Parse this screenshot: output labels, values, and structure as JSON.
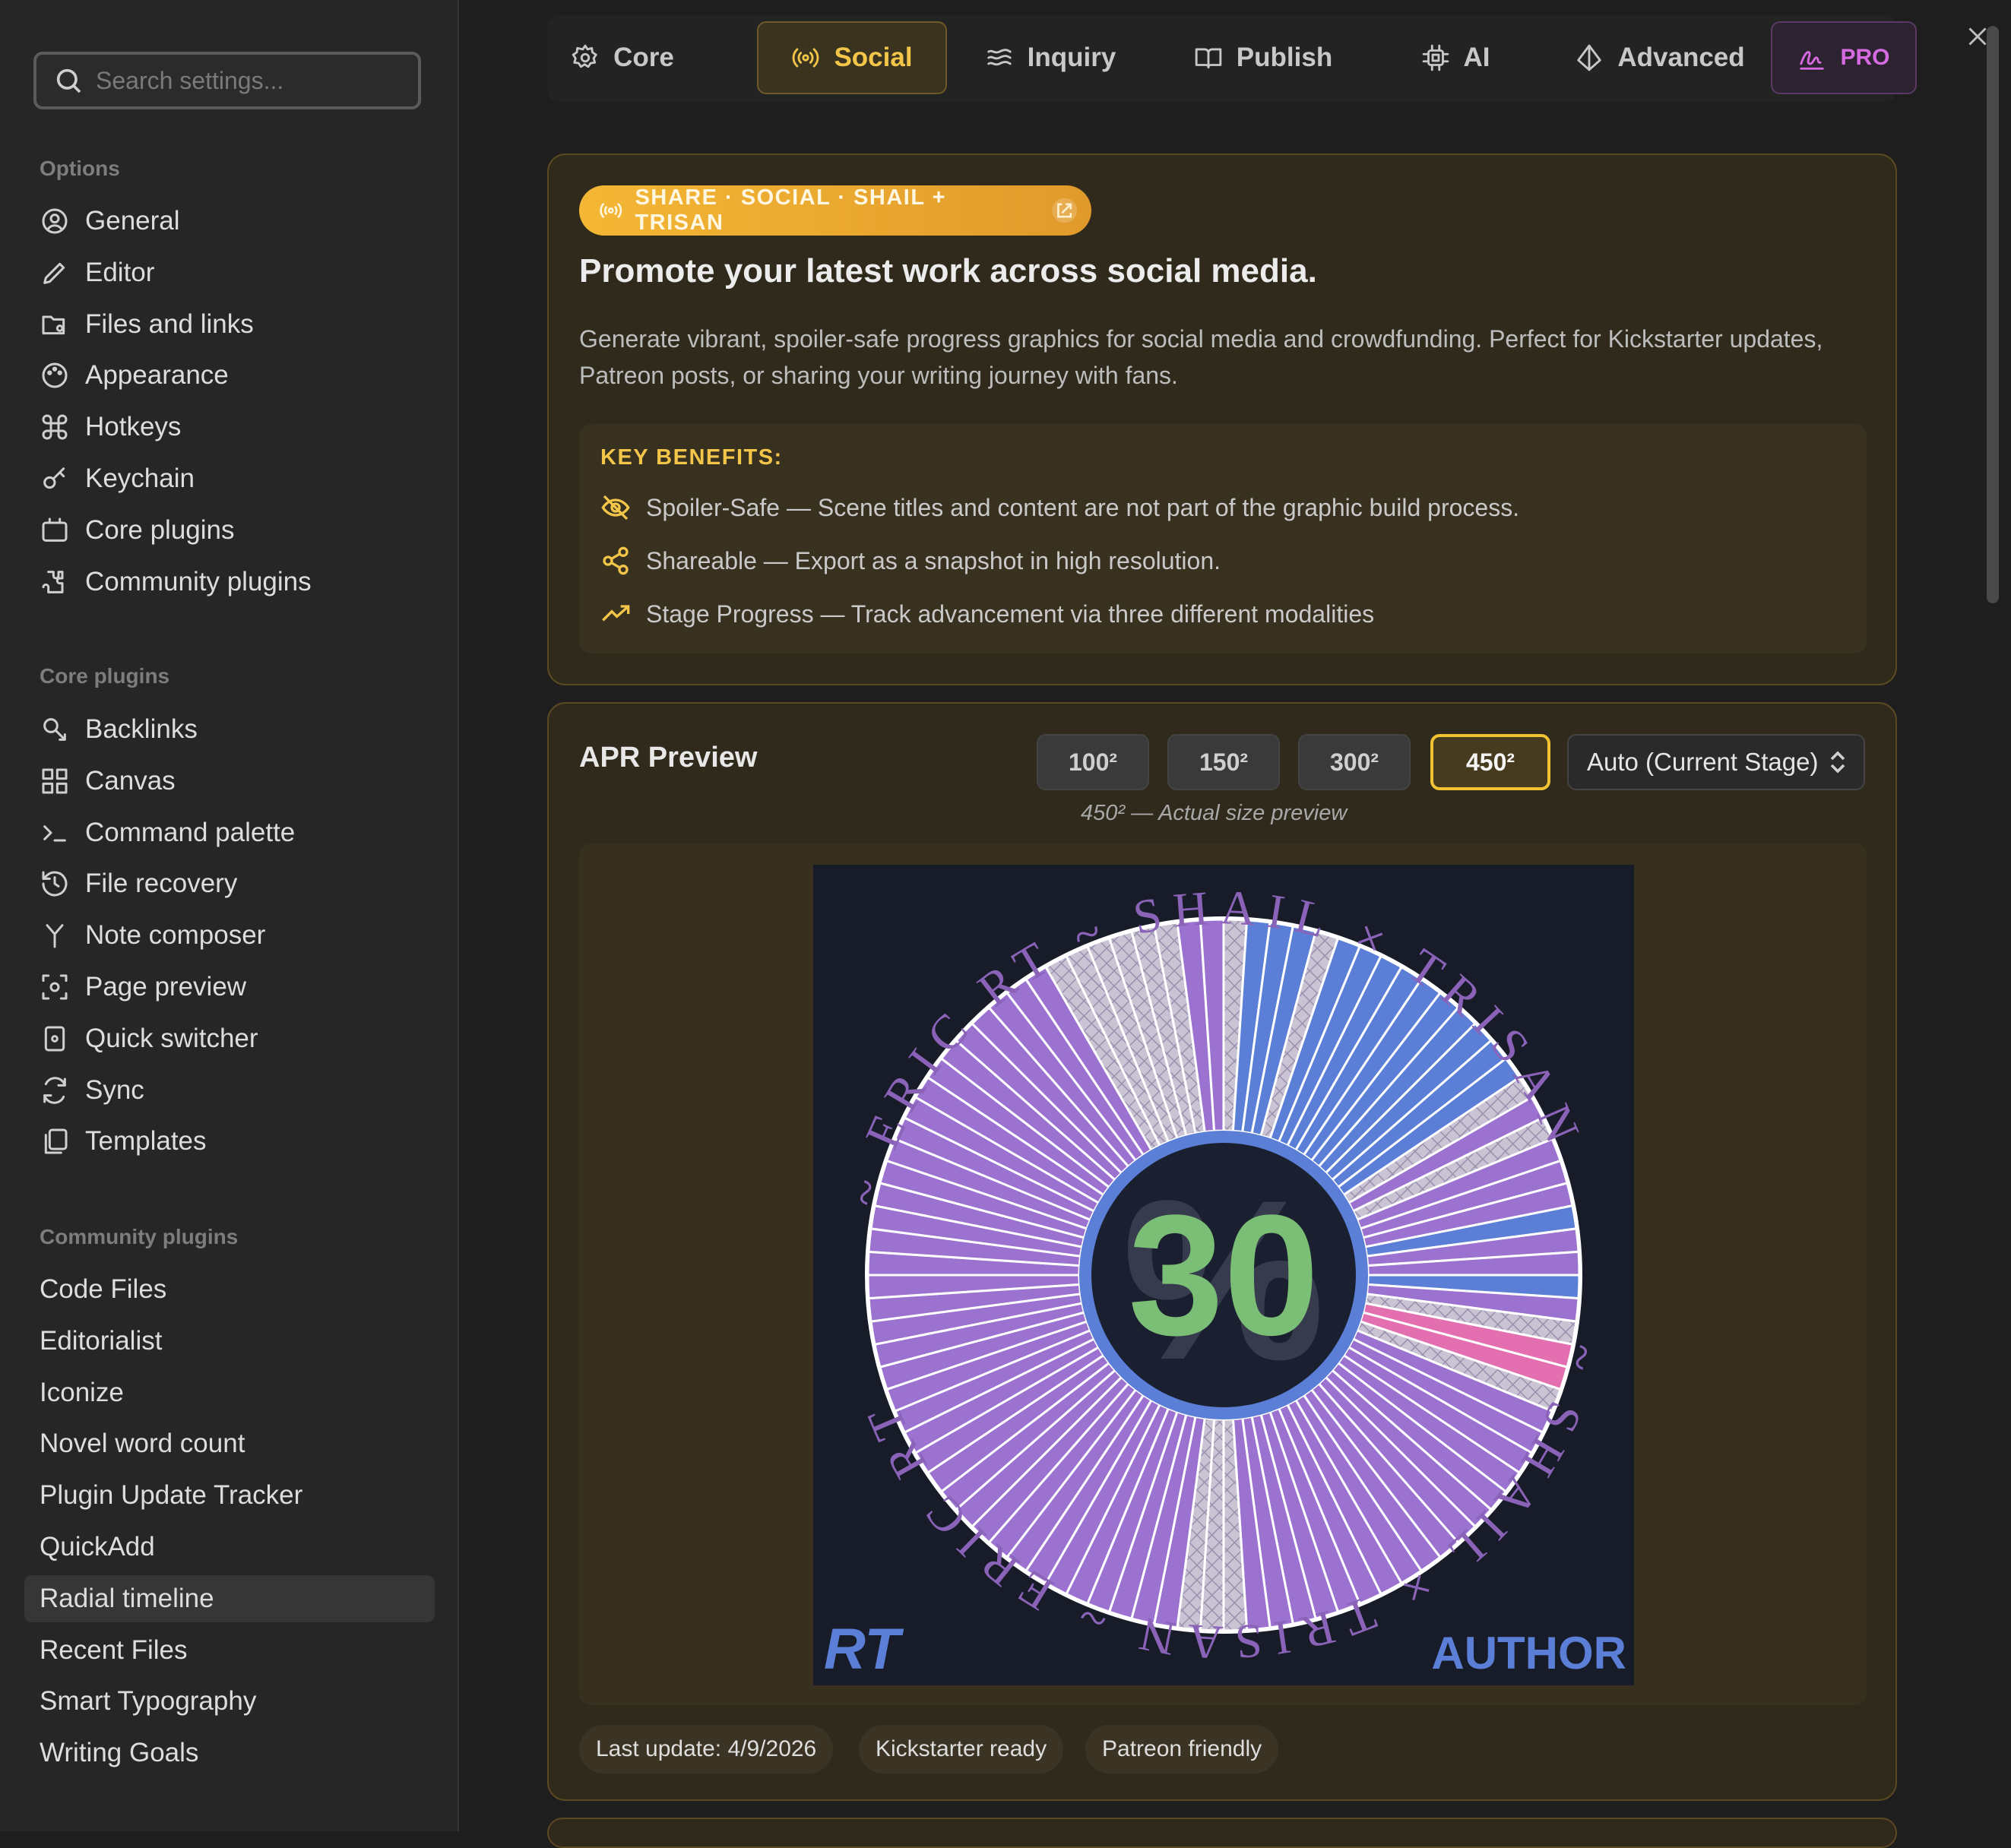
{
  "search": {
    "placeholder": "Search settings..."
  },
  "sidebar": {
    "options_title": "Options",
    "options": [
      "General",
      "Editor",
      "Files and links",
      "Appearance",
      "Hotkeys",
      "Keychain",
      "Core plugins",
      "Community plugins"
    ],
    "core_title": "Core plugins",
    "core": [
      "Backlinks",
      "Canvas",
      "Command palette",
      "File recovery",
      "Note composer",
      "Page preview",
      "Quick switcher",
      "Sync",
      "Templates"
    ],
    "community_title": "Community plugins",
    "community": [
      "Code Files",
      "Editorialist",
      "Iconize",
      "Novel word count",
      "Plugin Update Tracker",
      "QuickAdd",
      "Radial timeline",
      "Recent Files",
      "Smart Typography",
      "Writing Goals"
    ],
    "active": "Radial timeline"
  },
  "tabs": [
    {
      "label": "Core",
      "icon": "gear-icon"
    },
    {
      "label": "Social",
      "icon": "broadcast-icon",
      "active": true
    },
    {
      "label": "Inquiry",
      "icon": "waves-icon"
    },
    {
      "label": "Publish",
      "icon": "book-open-icon"
    },
    {
      "label": "AI",
      "icon": "cpu-icon"
    },
    {
      "label": "Advanced",
      "icon": "diamond-icon"
    },
    {
      "label": "PRO",
      "icon": "signature-icon"
    }
  ],
  "hero": {
    "badge": "SHARE · SOCIAL · SHAIL + TRISAN",
    "title": "Promote your latest work across social media.",
    "description": "Generate vibrant, spoiler-safe progress graphics for social media and crowdfunding. Perfect for Kickstarter updates, Patreon posts, or sharing your writing journey with fans.",
    "benefits_title": "KEY BENEFITS:",
    "benefits": [
      {
        "icon": "eye-off-icon",
        "text": "Spoiler-Safe — Scene titles and content are not part of the graphic build process."
      },
      {
        "icon": "share-icon",
        "text": "Shareable — Export as a snapshot in high resolution."
      },
      {
        "icon": "trending-up-icon",
        "text": "Stage Progress — Track advancement via three different modalities"
      }
    ]
  },
  "apr": {
    "title": "APR Preview",
    "sizes": [
      "100²",
      "150²",
      "300²",
      "450²"
    ],
    "active_size": "450²",
    "mode": "Auto (Current Stage)",
    "size_note": "450² — Actual size preview",
    "graphic": {
      "percent": "30",
      "ghost": "%",
      "ring_text_top": "~ ERIC RT ~ SHAIL × TRISAN",
      "ring_text_bottom": "~ SHAIL × TRISAN ~ ERIC RT",
      "logo": "RT",
      "role": "AUTHOR",
      "colors": {
        "purple": "#9b72d0",
        "blue": "#5b7fd6",
        "pink": "#e46fb0",
        "hatch": "#bdb6c8",
        "green": "#7bbf76",
        "bg": "#171c28"
      }
    },
    "chips": [
      "Last update: 4/9/2026",
      "Kickstarter ready",
      "Patreon friendly"
    ]
  }
}
